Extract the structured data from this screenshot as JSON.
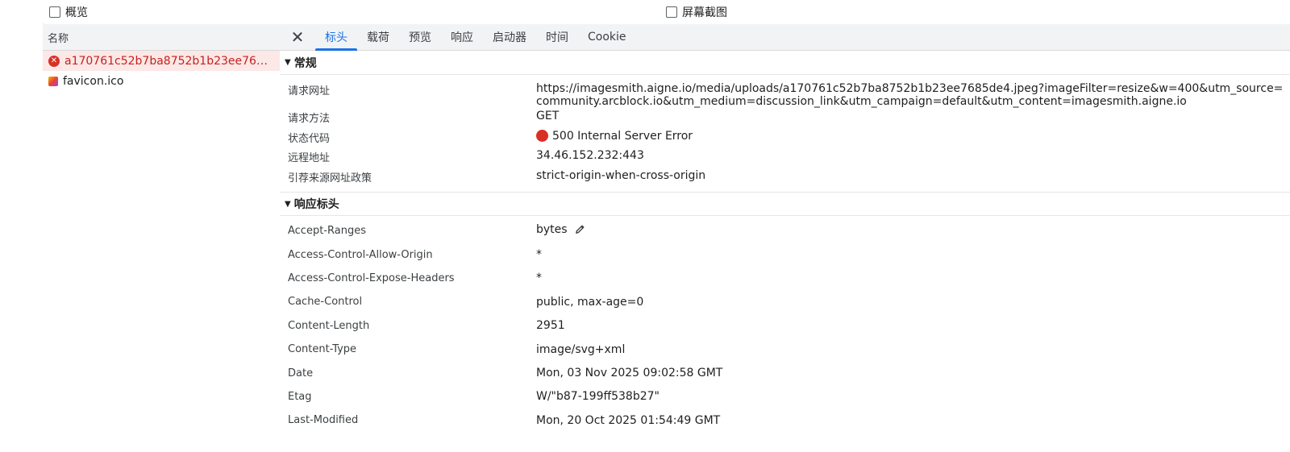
{
  "options": {
    "overview_label": "概览",
    "screenshot_label": "屏幕截图"
  },
  "request_list": {
    "header": "名称",
    "items": [
      {
        "name": "a170761c52b7ba8752b1b23ee7685de4.jpeg?imageFilter=resize&w=400",
        "display": "a170761c52b7ba8752b1b23ee768...",
        "status": "error"
      },
      {
        "name": "favicon.ico",
        "display": "favicon.ico",
        "status": "ok"
      }
    ]
  },
  "tabs": {
    "close_glyph": "✕",
    "items": [
      "标头",
      "载荷",
      "预览",
      "响应",
      "启动器",
      "时间",
      "Cookie"
    ],
    "active_index": 0
  },
  "general": {
    "title": "常规",
    "rows": [
      {
        "key": "请求网址",
        "value": "https://imagesmith.aigne.io/media/uploads/a170761c52b7ba8752b1b23ee7685de4.jpeg?imageFilter=resize&w=400&utm_source=community.arcblock.io&utm_medium=discussion_link&utm_campaign=default&utm_content=imagesmith.aigne.io"
      },
      {
        "key": "请求方法",
        "value": "GET"
      },
      {
        "key": "状态代码",
        "value": "500 Internal Server Error",
        "status_color": "#d93025"
      },
      {
        "key": "远程地址",
        "value": "34.46.152.232:443"
      },
      {
        "key": "引荐来源网址政策",
        "value": "strict-origin-when-cross-origin"
      }
    ]
  },
  "response_headers": {
    "title": "响应标头",
    "rows": [
      {
        "key": "Accept-Ranges",
        "value": "bytes"
      },
      {
        "key": "Access-Control-Allow-Origin",
        "value": "*"
      },
      {
        "key": "Access-Control-Expose-Headers",
        "value": "*"
      },
      {
        "key": "Cache-Control",
        "value": "public, max-age=0"
      },
      {
        "key": "Content-Length",
        "value": "2951"
      },
      {
        "key": "Content-Type",
        "value": "image/svg+xml"
      },
      {
        "key": "Date",
        "value": "Mon, 03 Nov 2025 09:02:58 GMT"
      },
      {
        "key": "Etag",
        "value": "W/\"b87-199ff538b27\""
      },
      {
        "key": "Last-Modified",
        "value": "Mon, 20 Oct 2025 01:54:49 GMT"
      }
    ]
  },
  "colors": {
    "accent": "#1a73e8",
    "error": "#d93025",
    "error_row_bg": "#fce8e6"
  }
}
